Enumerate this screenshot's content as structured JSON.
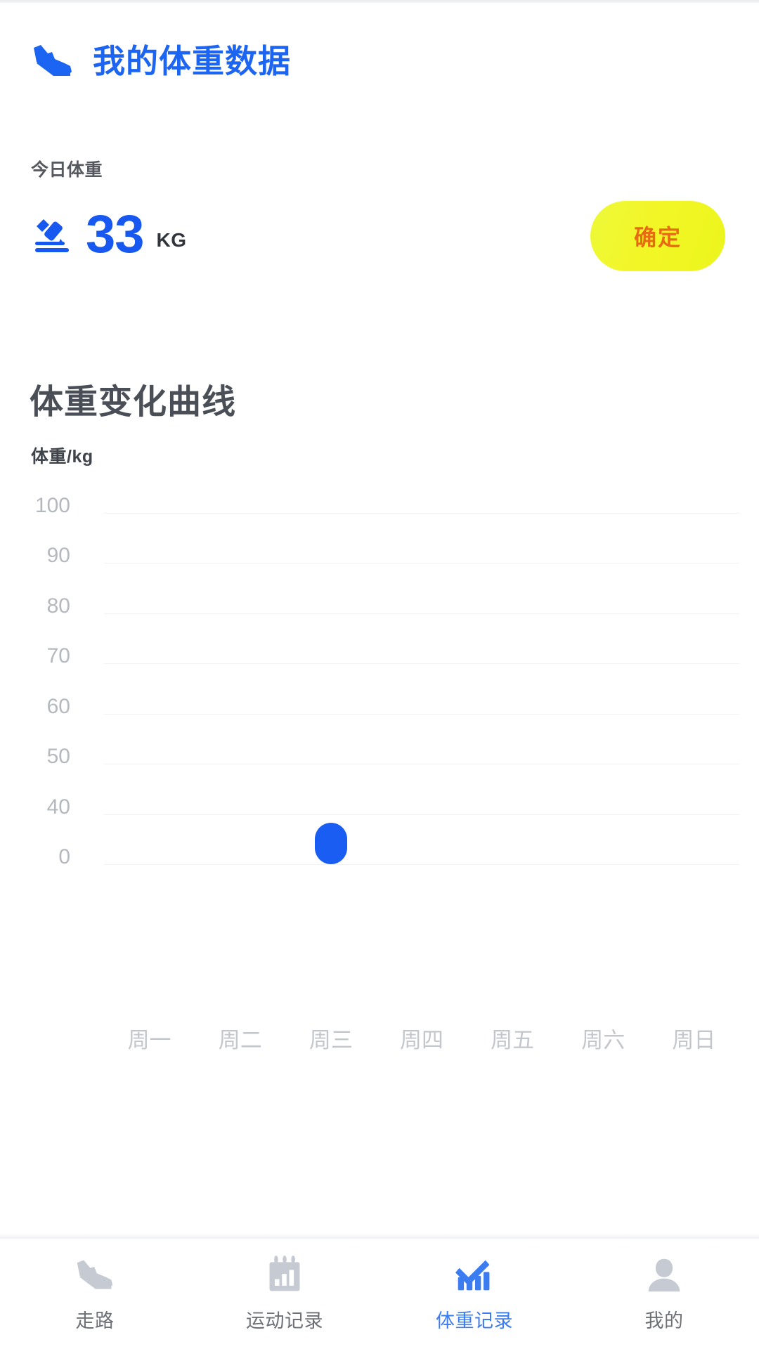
{
  "header": {
    "icon": "shoe-icon",
    "title": "我的体重数据",
    "accent_color": "#1c64f2"
  },
  "today": {
    "label": "今日体重",
    "icon": "weight-scale-pencil-icon",
    "value": "33",
    "unit": "KG",
    "value_color": "#1658f0"
  },
  "confirm_button": {
    "label": "确定",
    "background_color": "#eef62a",
    "text_color": "#e86a12"
  },
  "chart_section": {
    "title": "体重变化曲线",
    "axis_name": "体重/kg"
  },
  "chart_data": {
    "type": "bar",
    "title": "体重变化曲线",
    "xlabel": "",
    "ylabel": "体重/kg",
    "categories": [
      "周一",
      "周二",
      "周三",
      "周四",
      "周五",
      "周六",
      "周日"
    ],
    "values": [
      0,
      0,
      33,
      0,
      0,
      0,
      0
    ],
    "yticks": [
      100,
      90,
      80,
      70,
      60,
      50,
      40,
      0
    ],
    "ylim": [
      0,
      100
    ],
    "grid": true,
    "legend": "none",
    "series_color": "#1a5df2",
    "tick_color": "#b5b8bd",
    "gridline_color": "#f1f2f4"
  },
  "tabbar": {
    "items": [
      {
        "icon": "shoe-icon",
        "label": "走路",
        "active": false
      },
      {
        "icon": "chart-board-icon",
        "label": "运动记录",
        "active": false
      },
      {
        "icon": "check-bars-icon",
        "label": "体重记录",
        "active": true
      },
      {
        "icon": "person-icon",
        "label": "我的",
        "active": false
      }
    ],
    "active_color": "#3b7df0",
    "inactive_color": "#c6cad3"
  }
}
